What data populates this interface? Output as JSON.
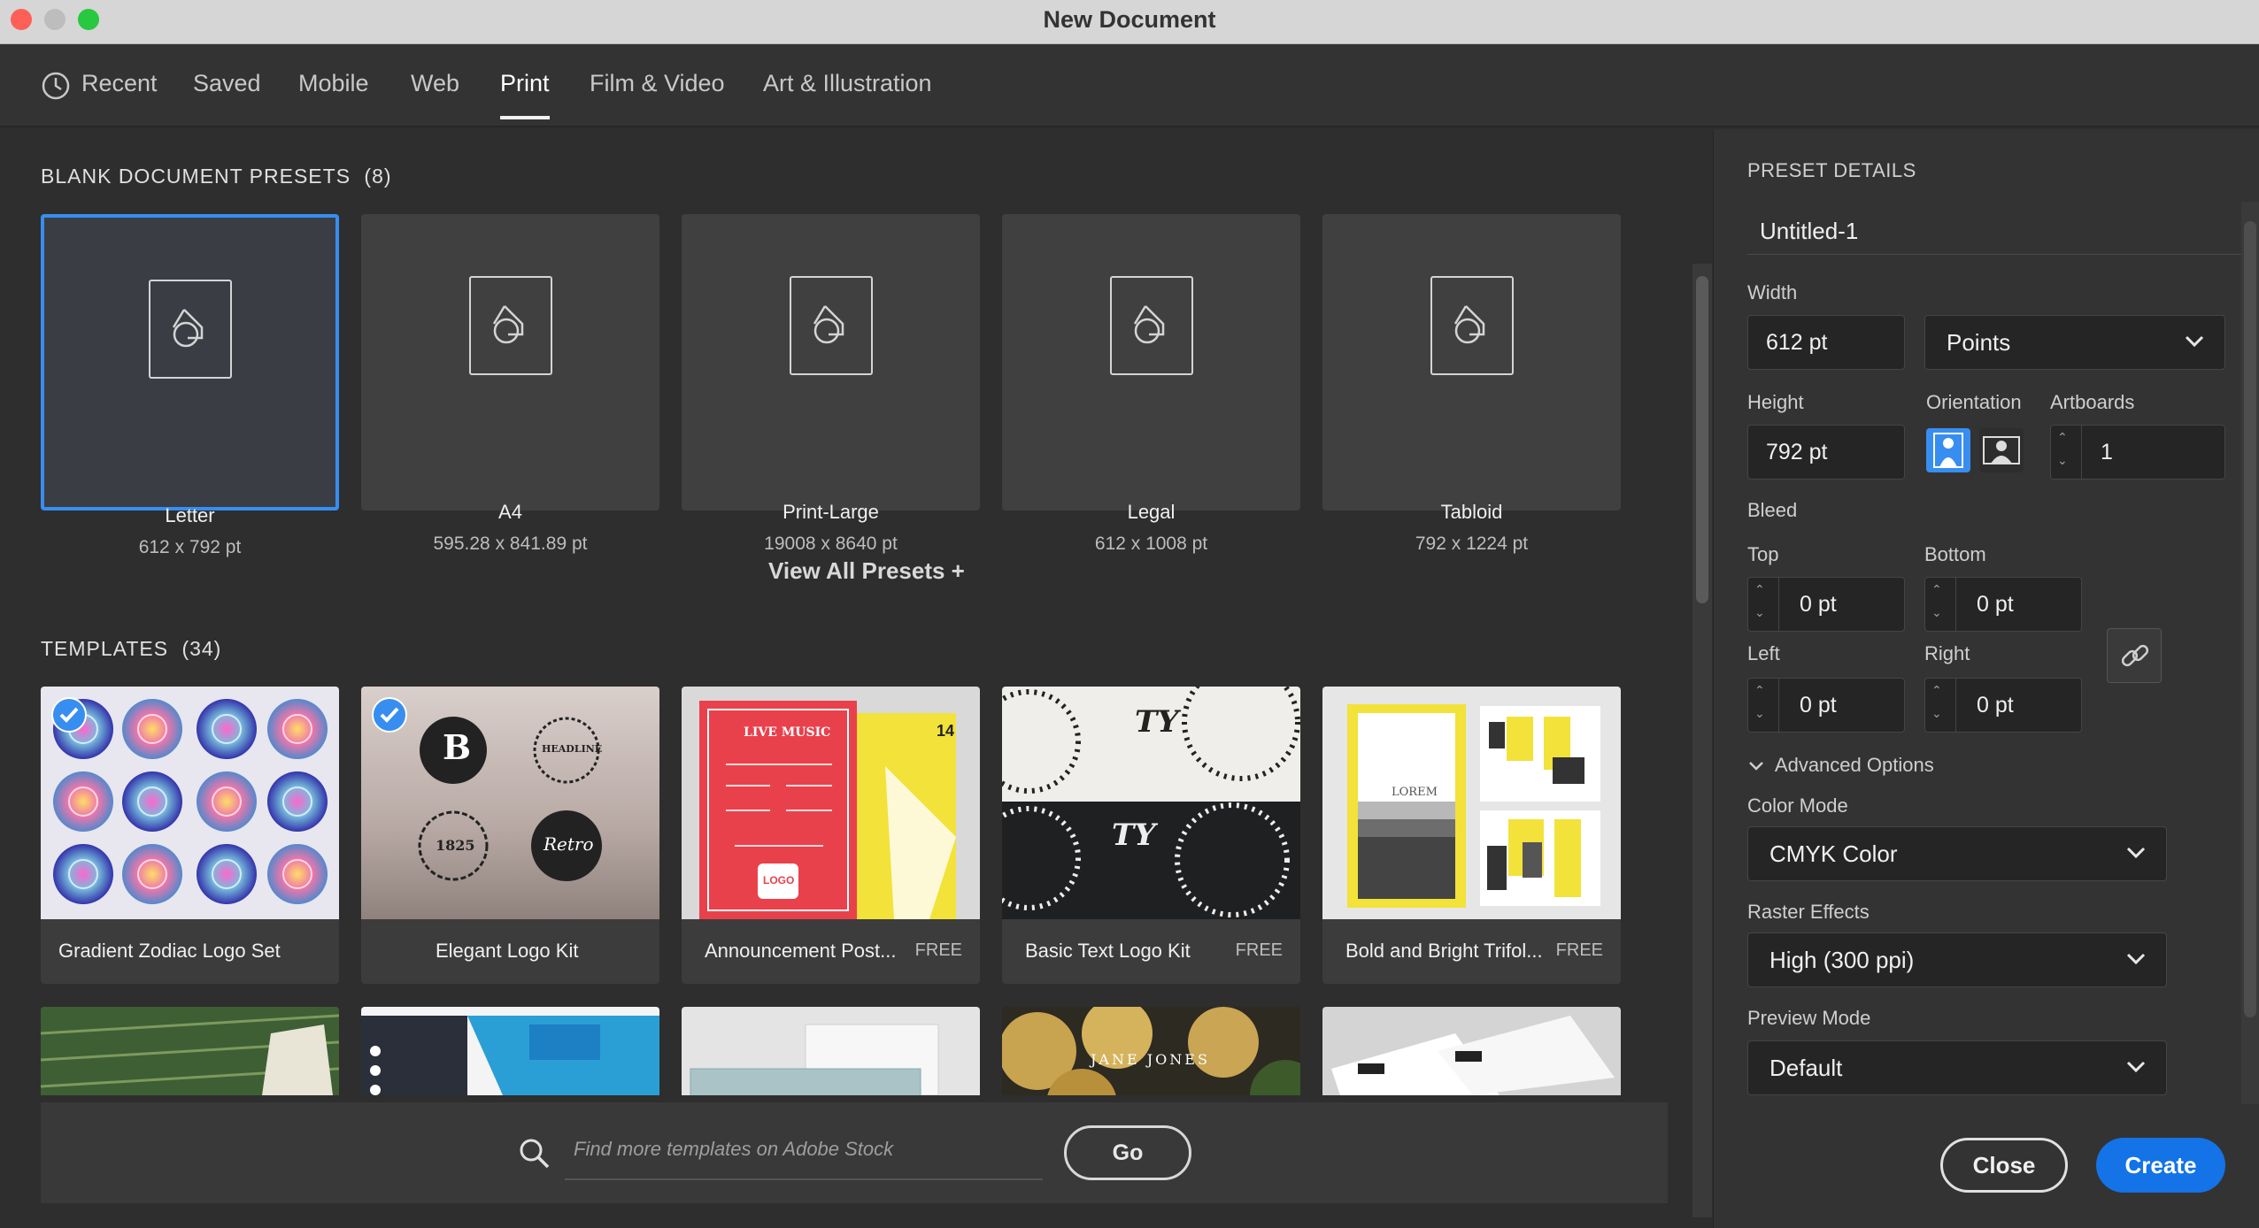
{
  "window": {
    "title": "New Document"
  },
  "tabs": [
    {
      "label": "Recent"
    },
    {
      "label": "Saved"
    },
    {
      "label": "Mobile"
    },
    {
      "label": "Web"
    },
    {
      "label": "Print"
    },
    {
      "label": "Film & Video"
    },
    {
      "label": "Art & Illustration"
    }
  ],
  "active_tab": "Print",
  "presets": {
    "heading": "BLANK DOCUMENT PRESETS",
    "count": "(8)",
    "items": [
      {
        "name": "Letter",
        "size": "612 x 792 pt"
      },
      {
        "name": "A4",
        "size": "595.28 x 841.89 pt"
      },
      {
        "name": "Print-Large",
        "size": "19008 x 8640 pt"
      },
      {
        "name": "Legal",
        "size": "612 x 1008 pt"
      },
      {
        "name": "Tabloid",
        "size": "792 x 1224 pt"
      }
    ],
    "view_all": "View All Presets +"
  },
  "templates": {
    "heading": "TEMPLATES",
    "count": "(34)",
    "items": [
      {
        "name": "Gradient Zodiac Logo Set",
        "badge": ""
      },
      {
        "name": "Elegant Logo Kit",
        "badge": ""
      },
      {
        "name": "Announcement Post...",
        "badge": "FREE"
      },
      {
        "name": "Basic Text Logo Kit",
        "badge": "FREE"
      },
      {
        "name": "Bold and Bright Trifol...",
        "badge": "FREE"
      }
    ],
    "thumb_text": {
      "elegant_b": "B",
      "elegant_headline": "HEADLINE",
      "elegant_year": "1825",
      "elegant_retro": "Retro",
      "announce_live": "LIVE MUSIC",
      "announce_logo": "LOGO",
      "announce_date": "14",
      "textlogo_ty": "TY",
      "trifold_lorem": "LOREM",
      "row2_name": "JANE JONES"
    }
  },
  "stock_search": {
    "placeholder": "Find more templates on Adobe Stock",
    "go": "Go"
  },
  "preset_details": {
    "heading": "PRESET DETAILS",
    "doc_name": "Untitled-1",
    "width_label": "Width",
    "width_value": "612 pt",
    "units": "Points",
    "height_label": "Height",
    "height_value": "792 pt",
    "orientation_label": "Orientation",
    "artboards_label": "Artboards",
    "artboards_value": "1",
    "bleed_label": "Bleed",
    "top_label": "Top",
    "top_value": "0 pt",
    "bottom_label": "Bottom",
    "bottom_value": "0 pt",
    "left_label": "Left",
    "left_value": "0 pt",
    "right_label": "Right",
    "right_value": "0 pt",
    "advanced_label": "Advanced Options",
    "color_mode_label": "Color Mode",
    "color_mode_value": "CMYK Color",
    "raster_label": "Raster Effects",
    "raster_value": "High (300 ppi)",
    "preview_label": "Preview Mode",
    "preview_value": "Default"
  },
  "actions": {
    "close": "Close",
    "create": "Create"
  },
  "colors": {
    "accent": "#378ef0",
    "create_button": "#1473e6",
    "titlebar": "#d6d6d6"
  }
}
